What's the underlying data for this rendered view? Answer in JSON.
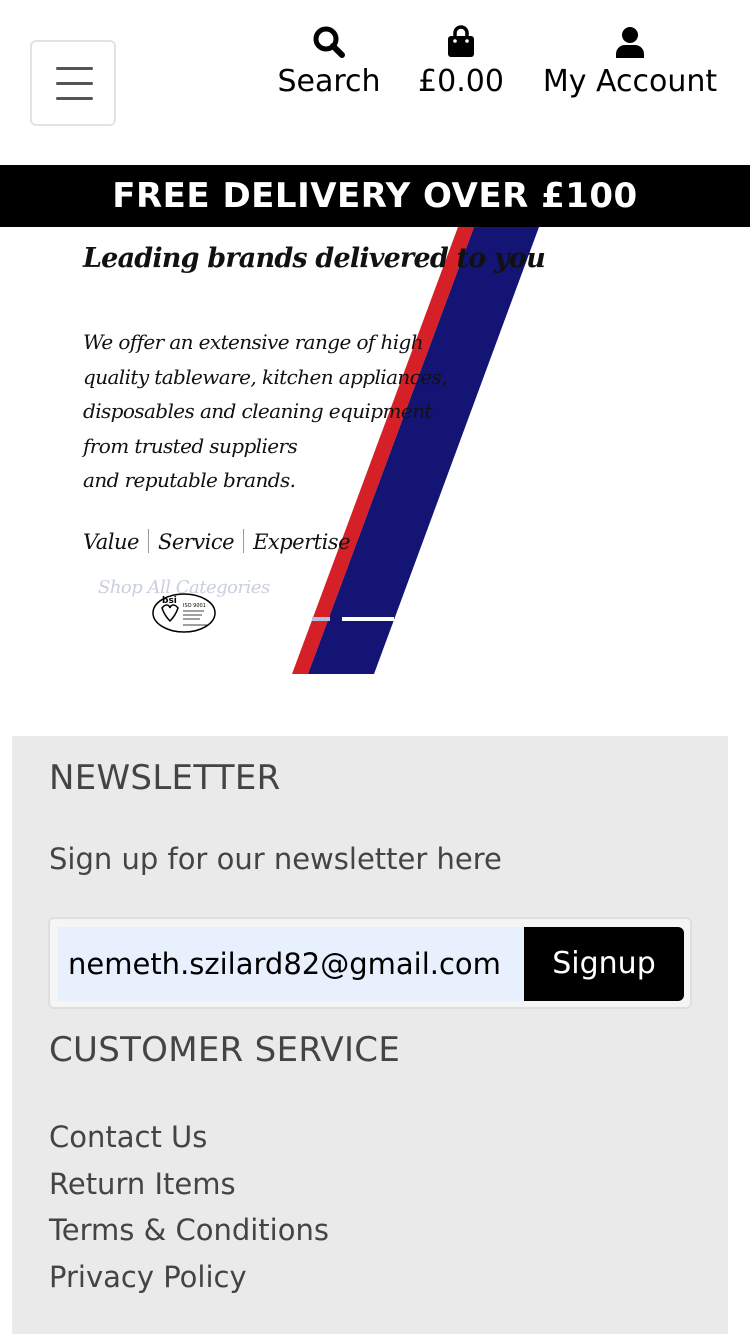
{
  "header": {
    "search_label": "Search",
    "cart_total": "£0.00",
    "account_label": "My Account"
  },
  "delivery_banner": "FREE DELIVERY OVER £100",
  "hero": {
    "title": "Leading brands delivered to you",
    "copy_lines": [
      "We offer an extensive range of high",
      "quality tableware, kitchen appliances,",
      "disposables and cleaning equipment",
      "from trusted suppliers",
      "and reputable brands."
    ],
    "values": [
      "Value",
      "Service",
      "Expertise"
    ],
    "shop_link": "Shop All Categories",
    "certification_logo": "bsi",
    "colors": {
      "red": "#d62027",
      "navy": "#141474"
    }
  },
  "newsletter": {
    "heading": "NEWSLETTER",
    "text": "Sign up for our newsletter here",
    "email_value": "nemeth.szilard82@gmail.com",
    "signup_label": "Signup"
  },
  "customer_service": {
    "heading": "CUSTOMER SERVICE",
    "links": [
      "Contact Us",
      "Return Items",
      "Terms & Conditions",
      "Privacy Policy"
    ]
  },
  "icons": {
    "menu": "hamburger-menu-icon",
    "search": "search-icon",
    "cart": "shopping-bag-icon",
    "account": "user-icon"
  }
}
